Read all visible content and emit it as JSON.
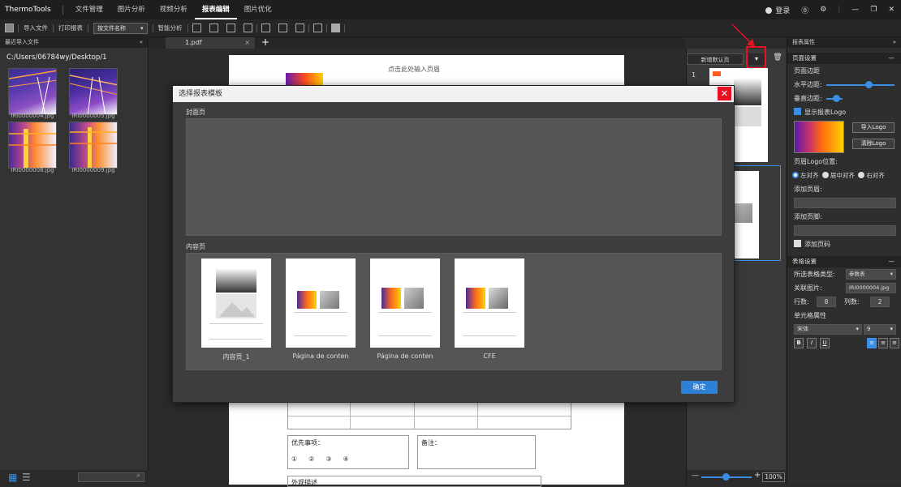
{
  "titlebar": {
    "app_name": "ThermoTools",
    "menus": [
      "文件管理",
      "图片分析",
      "视频分析",
      "报表编辑",
      "图片优化"
    ],
    "active_menu": "报表编辑",
    "login": "登录"
  },
  "toolbar": {
    "import": "导入文件",
    "print": "打印报表",
    "filename_select": "按文件名称",
    "smart_analysis": "智能分析"
  },
  "left_panel": {
    "title": "最近导入文件",
    "path": "C:/Users/06784wy/Desktop/1",
    "files": [
      "IRI0000004.jpg",
      "IRI0000005.jpg",
      "IRI0000008.jpg",
      "IRI0000009.jpg"
    ]
  },
  "tabs": {
    "doc_tab": "1.pdf",
    "add": "+"
  },
  "document": {
    "header_placeholder": "点击此处输入页眉",
    "priority_label": "优先事项：",
    "priority_options": [
      "①",
      "②",
      "③",
      "④"
    ],
    "remarks_label": "备注：",
    "bottom_text": "外观描述"
  },
  "preview": {
    "new_default_page": "新增默认页",
    "page_number": "1",
    "zoom": "100%",
    "zoom_minus": "—",
    "zoom_plus": "+"
  },
  "properties": {
    "title": "报表属性",
    "page_settings": "页面设置",
    "page_margin": "页面边距",
    "horizontal_margin": "水平边距:",
    "vertical_margin": "垂直边距:",
    "show_logo": "显示报表Logo",
    "import_logo": "导入Logo",
    "clear_logo": "清除Logo",
    "logo_position": "页眉Logo位置:",
    "align_left": "左对齐",
    "align_center": "居中对齐",
    "align_right": "右对齐",
    "add_header": "添加页眉:",
    "add_footer": "添加页脚:",
    "add_page_number": "添加页码",
    "table_settings": "表格设置",
    "table_type_label": "所选表格类型:",
    "table_type_value": "参数表",
    "related_image_label": "关联图片:",
    "related_image_value": "IRI0000004.jpg",
    "rows_label": "行数:",
    "rows_value": "8",
    "cols_label": "列数:",
    "cols_value": "2",
    "cell_props": "单元格属性",
    "font_value": "宋体",
    "font_size": "9",
    "bold": "B",
    "italic": "I",
    "underline": "U"
  },
  "modal": {
    "title": "选择报表模板",
    "close": "✕",
    "cover_label": "封面页",
    "content_label": "内容页",
    "templates": [
      "内容页_1",
      "Página de conten",
      "Página de conten",
      "CFE"
    ],
    "ok": "确定"
  }
}
